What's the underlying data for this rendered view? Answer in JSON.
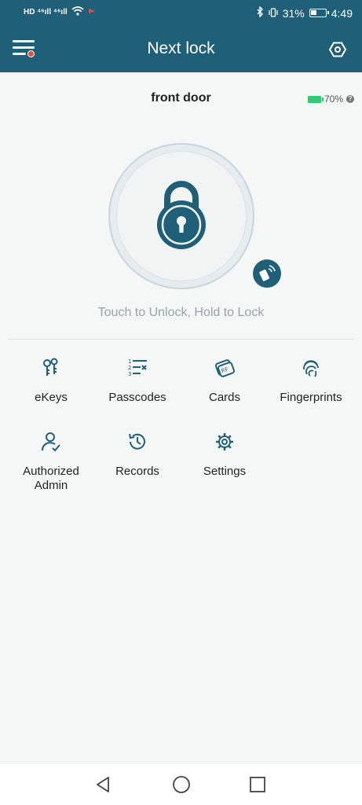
{
  "status": {
    "left_text": "HD ⁴⁶ıll ⁴⁶ıll",
    "battery_pct": "31%",
    "time": "4:49"
  },
  "header": {
    "title": "Next lock"
  },
  "device": {
    "name": "front door",
    "battery": "70%"
  },
  "lock": {
    "hint": "Touch to Unlock, Hold to Lock"
  },
  "menu": {
    "ekeys": "eKeys",
    "passcodes": "Passcodes",
    "cards": "Cards",
    "fingerprints": "Fingerprints",
    "admin_line1": "Authorized",
    "admin_line2": "Admin",
    "records": "Records",
    "settings": "Settings"
  },
  "colors": {
    "accent": "#205f78",
    "battery": "#2ecc71",
    "badge": "#e74c3c"
  },
  "icons": [
    "menu-icon",
    "hexagon-settings-icon",
    "padlock-icon",
    "nfc-phone-icon",
    "ekeys-icon",
    "passcodes-icon",
    "cards-icon",
    "fingerprint-icon",
    "admin-icon",
    "records-icon",
    "settings-gear-icon",
    "back-icon",
    "home-icon",
    "recents-icon"
  ]
}
